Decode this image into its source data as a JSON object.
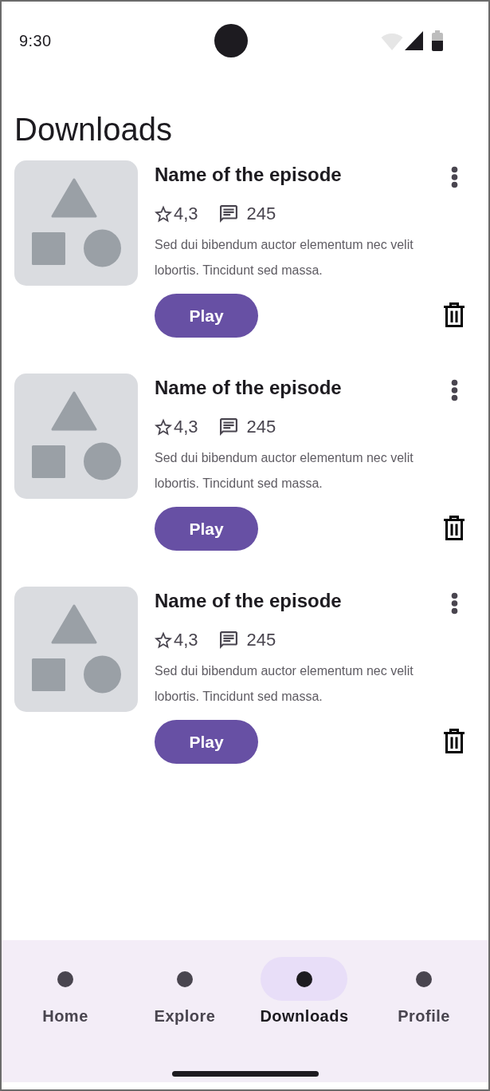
{
  "status_bar": {
    "time": "9:30"
  },
  "page_title": "Downloads",
  "episodes": [
    {
      "title": "Name of the episode",
      "rating": "4,3",
      "comments": "245",
      "description": "Sed dui bibendum auctor elementum nec velit lobortis. Tincidunt sed massa.",
      "action": "Play"
    },
    {
      "title": "Name of the episode",
      "rating": "4,3",
      "comments": "245",
      "description": "Sed dui bibendum auctor elementum nec velit lobortis. Tincidunt sed massa.",
      "action": "Play"
    },
    {
      "title": "Name of the episode",
      "rating": "4,3",
      "comments": "245",
      "description": "Sed dui bibendum auctor elementum nec velit lobortis. Tincidunt sed massa.",
      "action": "Play"
    }
  ],
  "nav": [
    {
      "label": "Home",
      "selected": false
    },
    {
      "label": "Explore",
      "selected": false
    },
    {
      "label": "Downloads",
      "selected": true
    },
    {
      "label": "Profile",
      "selected": false
    }
  ]
}
